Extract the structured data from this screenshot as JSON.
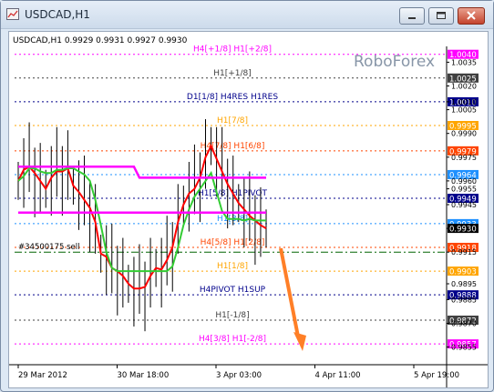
{
  "window": {
    "title": "USDCAD,H1"
  },
  "chart_data": {
    "type": "line",
    "symbol_header": "USDCAD,H1  0.9929 0.9931 0.9927 0.9930",
    "watermark": "RoboForex",
    "ylim": [
      0.9845,
      1.0045
    ],
    "x_ticks": [
      "29 Mar 2012",
      "30 Mar 18:00",
      "3 Apr 03:00",
      "4 Apr 11:00",
      "5 Apr 19:00"
    ],
    "y_ticks": [
      "1.0035",
      "1.0020",
      "1.0010",
      "1.0005",
      "0.9990",
      "0.9975",
      "0.9960",
      "0.9955",
      "0.9945",
      "0.9930",
      "0.9915",
      "0.9895",
      "0.9885",
      "0.9870",
      "0.9855"
    ],
    "current_price": "0.9930",
    "levels": [
      {
        "price": 1.004,
        "label_left": "H4[+1/8] H1[+2/8]",
        "price_label": "1.0040",
        "color": "#ff00ff"
      },
      {
        "price": 1.0025,
        "label_left": "H1[+1/8]",
        "price_label": "1.0025",
        "color": "#404040"
      },
      {
        "price": 1.001,
        "label_left": "D1[1/8] H4RES H1RES",
        "price_label": "1.0010",
        "color": "#00008b"
      },
      {
        "price": 0.9995,
        "label_left": "H1[7/8]",
        "price_label": "0.9995",
        "color": "#ffa500"
      },
      {
        "price": 0.9979,
        "label_left": "H4[7/8] H1[6/8]",
        "price_label": "0.9979",
        "color": "#ff4500"
      },
      {
        "price": 0.9964,
        "label_left": "",
        "price_label": "0.9964",
        "color": "#1e90ff"
      },
      {
        "price": 0.9949,
        "label_left": "H1[5/8] H1PIVOT",
        "price_label": "0.9949",
        "color": "#00008b"
      },
      {
        "price": 0.9933,
        "label_left": "H1[3/8]",
        "price_label": "0.9933",
        "color": "#1e90ff"
      },
      {
        "price": 0.9918,
        "label_left": "H4[5/8] H1[2/8]",
        "price_label": "0.9918",
        "color": "#ff4500"
      },
      {
        "price": 0.9903,
        "label_left": "H1[1/8]",
        "price_label": "0.9903",
        "color": "#ffa500"
      },
      {
        "price": 0.9888,
        "label_left": "H4PIVOT H1SUP",
        "price_label": "0.9888",
        "color": "#00008b"
      },
      {
        "price": 0.9872,
        "label_left": "H1[-1/8]",
        "price_label": "0.9872",
        "color": "#404040"
      },
      {
        "price": 0.9857,
        "label_left": "H4[3/8] H1[-2/8]",
        "price_label": "0.9857",
        "color": "#ff00ff"
      }
    ],
    "order_line": {
      "label": "#34500175 sell"
    },
    "series": [
      {
        "values": [
          0.996,
          0.9967,
          0.9969,
          0.9965,
          0.996,
          0.9955,
          0.9962,
          0.9966,
          0.9966,
          0.9968,
          0.9957,
          0.9953,
          0.9948,
          0.9943,
          0.9934,
          0.9914,
          0.9912,
          0.9905,
          0.9903,
          0.99,
          0.9895,
          0.9892,
          0.9892,
          0.9893,
          0.99,
          0.9905,
          0.9904,
          0.991,
          0.9918,
          0.9934,
          0.9945,
          0.9952,
          0.9955,
          0.9962,
          0.9975,
          0.9982,
          0.9974,
          0.9966,
          0.9958,
          0.9952,
          0.9946,
          0.9942,
          0.9938,
          0.9935,
          0.9932,
          0.993
        ],
        "color": "#ff0000"
      },
      {
        "values": [
          0.996,
          0.9963,
          0.9968,
          0.9968,
          0.9966,
          0.9965,
          0.9965,
          0.9967,
          0.9967,
          0.9968,
          0.9968,
          0.9966,
          0.9964,
          0.996,
          0.9948,
          0.9932,
          0.9915,
          0.9905,
          0.9903,
          0.9903,
          0.9903,
          0.9903,
          0.9903,
          0.9903,
          0.9903,
          0.9903,
          0.9903,
          0.9903,
          0.9906,
          0.9918,
          0.9932,
          0.9942,
          0.995,
          0.9955,
          0.996,
          0.9965,
          0.9953,
          0.9941,
          0.9936,
          0.9936,
          0.9936,
          0.9935,
          0.9936,
          0.9935,
          0.9935,
          0.9935
        ],
        "color": "#33cc33"
      },
      {
        "values": [
          0.9969,
          0.9969,
          0.9969,
          0.9969,
          0.9969,
          0.9969,
          0.9969,
          0.9969,
          0.9969,
          0.9969,
          0.9969,
          0.9969,
          0.9969,
          0.9969,
          0.9969,
          0.9969,
          0.9969,
          0.9969,
          0.9969,
          0.9969,
          0.9969,
          0.9969,
          0.9962,
          0.9962,
          0.9962,
          0.9962,
          0.9962,
          0.9962,
          0.9962,
          0.9962,
          0.9962,
          0.9962,
          0.9962,
          0.9962,
          0.9962,
          0.9962,
          0.9962,
          0.9962,
          0.9962,
          0.9962,
          0.9962,
          0.9962,
          0.9962,
          0.9962,
          0.9962,
          0.9962
        ],
        "color": "#ff00ff"
      },
      {
        "values": [
          0.994,
          0.994,
          0.994,
          0.994,
          0.994,
          0.994,
          0.994,
          0.994,
          0.994,
          0.994,
          0.994,
          0.994,
          0.994,
          0.994,
          0.994,
          0.994,
          0.994,
          0.994,
          0.994,
          0.994,
          0.994,
          0.994,
          0.994,
          0.994,
          0.994,
          0.994,
          0.994,
          0.994,
          0.994,
          0.994,
          0.994,
          0.994,
          0.994,
          0.994,
          0.994,
          0.994,
          0.994,
          0.994,
          0.994,
          0.994,
          0.994,
          0.994,
          0.994,
          0.994,
          0.994,
          0.994
        ],
        "color": "#ff00ff"
      }
    ]
  }
}
